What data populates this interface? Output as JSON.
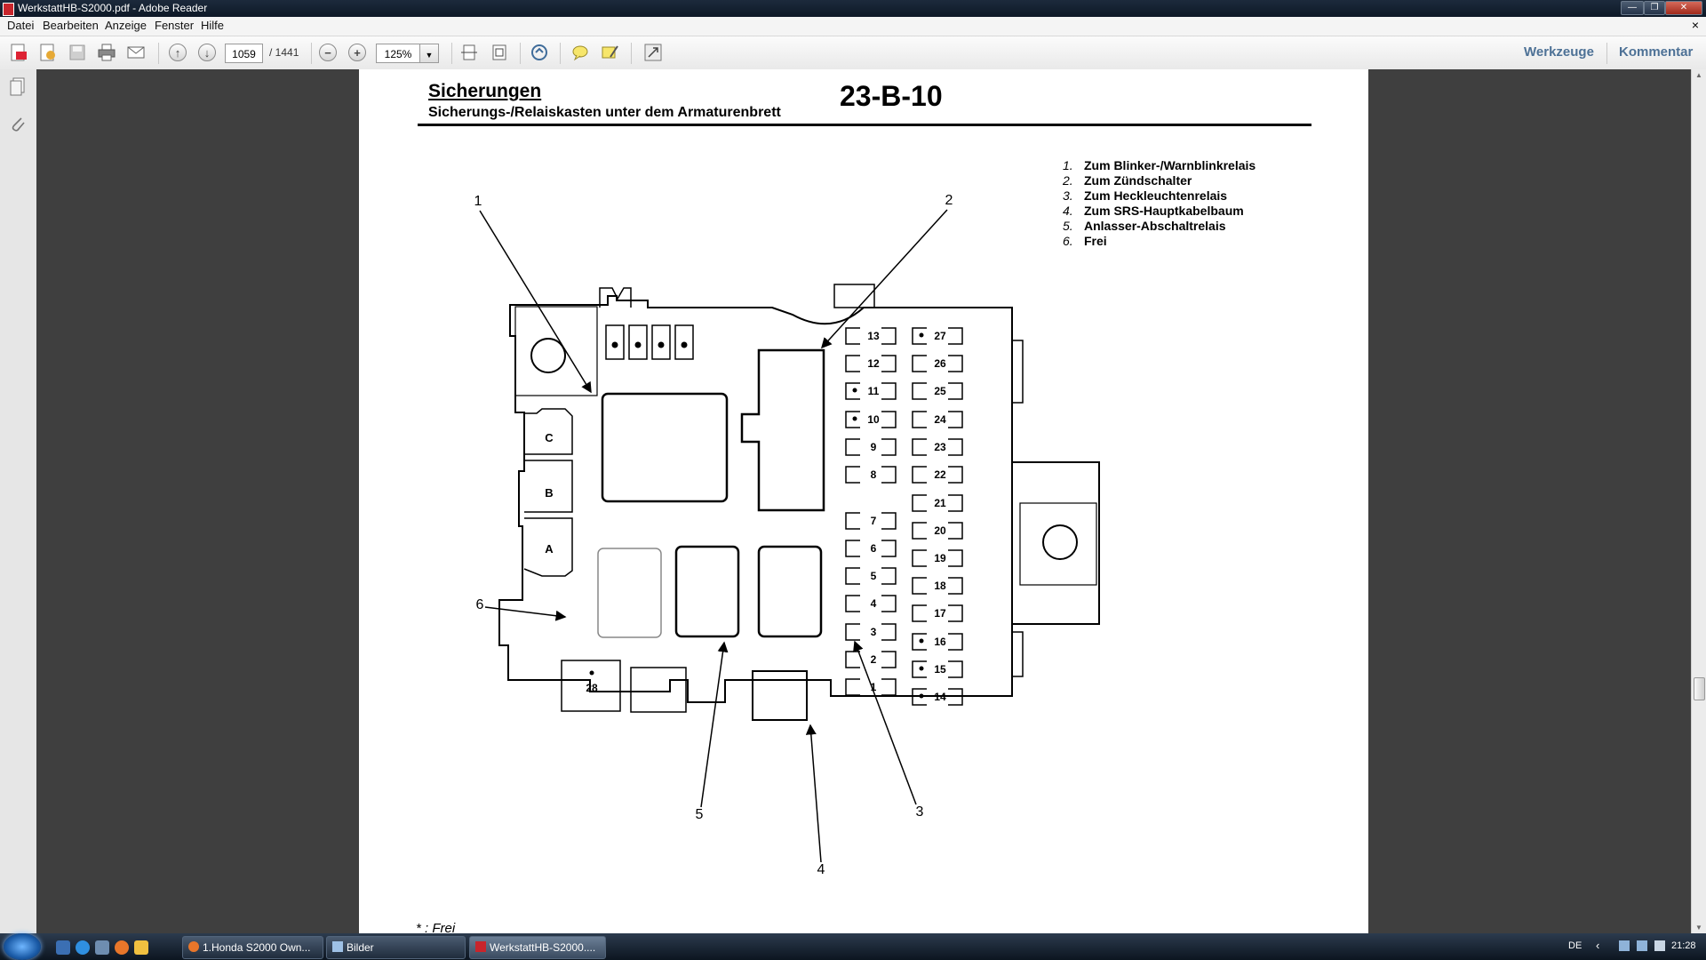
{
  "window": {
    "title": "WerkstattHB-S2000.pdf - Adobe Reader",
    "buttons": [
      "—",
      "❐",
      "✕"
    ]
  },
  "menu": [
    "Datei",
    "Bearbeiten",
    "Anzeige",
    "Fenster",
    "Hilfe"
  ],
  "menu_close": "×",
  "toolbar": {
    "page_current": "1059",
    "page_total": "/ 1441",
    "zoom": "125%",
    "tools_label": "Werkzeuge",
    "comment_label": "Kommentar"
  },
  "document": {
    "section_title": "Sicherungen",
    "section_subtitle": "Sicherungs-/Relaiskasten unter dem Armaturenbrett",
    "page_code": "23-B-10",
    "legend": [
      {
        "num": "1.",
        "text": "Zum Blinker-/Warnblinkrelais"
      },
      {
        "num": "2.",
        "text": "Zum Zündschalter"
      },
      {
        "num": "3.",
        "text": "Zum Heckleuchtenrelais"
      },
      {
        "num": "4.",
        "text": "Zum SRS-Hauptkabelbaum"
      },
      {
        "num": "5.",
        "text": "Anlasser-Abschaltrelais"
      },
      {
        "num": "6.",
        "text": "Frei"
      }
    ],
    "footnote": "* : Frei",
    "diagram": {
      "callouts": [
        "1",
        "2",
        "3",
        "4",
        "5",
        "6"
      ],
      "connectors": [
        "C",
        "B",
        "A"
      ],
      "left_fuses": [
        "13",
        "12",
        "11",
        "10",
        "9",
        "8",
        "7",
        "6",
        "5",
        "4",
        "3",
        "2",
        "1"
      ],
      "right_fuses": [
        "27",
        "26",
        "25",
        "24",
        "23",
        "22",
        "21",
        "20",
        "19",
        "18",
        "17",
        "16",
        "15",
        "14"
      ],
      "bottom_fuse": "28"
    }
  },
  "taskbar": {
    "tasks": [
      "1.Honda S2000 Own...",
      "Bilder",
      "WerkstattHB-S2000...."
    ],
    "lang": "DE",
    "clock": "21:28",
    "tray_arrow": "‹"
  }
}
